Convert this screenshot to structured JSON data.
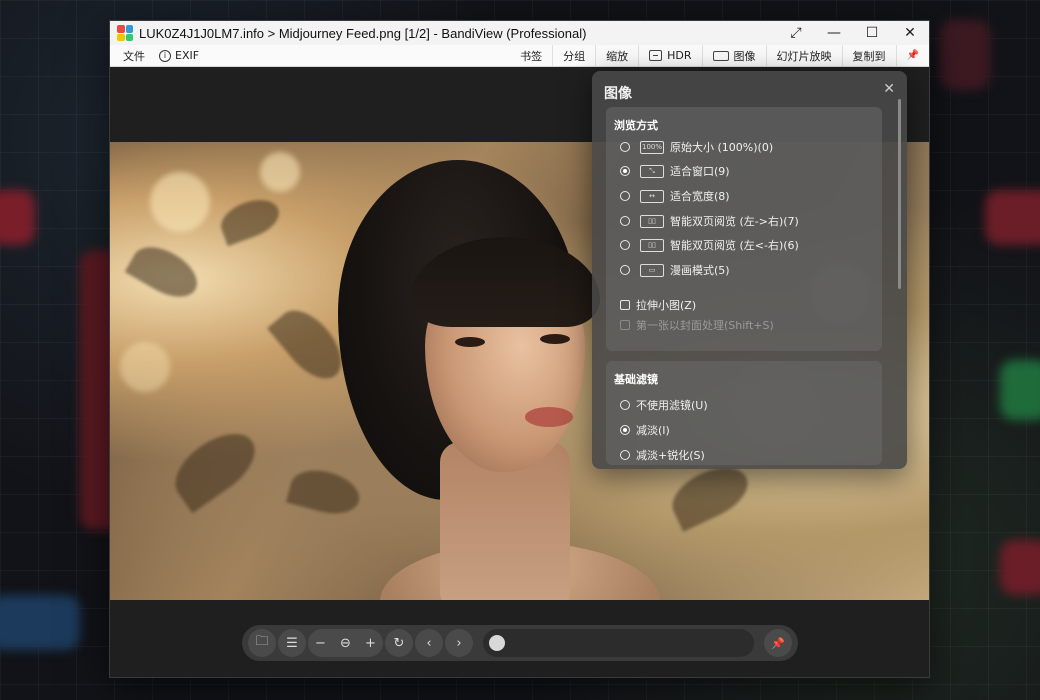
{
  "window": {
    "title": "LUK0Z4J1J0LM7.info > Midjourney Feed.png [1/2] - BandiView (Professional)",
    "controls": {
      "fullscreen": "⤢",
      "minimize": "—",
      "maximize": "☐",
      "close": "✕"
    }
  },
  "menubar": {
    "left": {
      "file": "文件",
      "exif": "EXIF"
    },
    "right": {
      "bookmark": "书签",
      "group": "分组",
      "zoom": "缩放",
      "hdr": "HDR",
      "image": "图像",
      "slideshow": "幻灯片放映",
      "copy_to": "复制到",
      "pin": "📌"
    }
  },
  "panel": {
    "title": "图像",
    "close": "✕",
    "view_mode": {
      "title": "浏览方式",
      "options": [
        {
          "icon": "100%",
          "label": "原始大小 (100%)(0)",
          "selected": false
        },
        {
          "icon": "fit-window",
          "label": "适合窗口(9)",
          "selected": true
        },
        {
          "icon": "fit-width",
          "label": "适合宽度(8)",
          "selected": false
        },
        {
          "icon": "two-page-ltr",
          "label": "智能双页阅览 (左->右)(7)",
          "selected": false
        },
        {
          "icon": "two-page-rtl",
          "label": "智能双页阅览 (左<-右)(6)",
          "selected": false
        },
        {
          "icon": "comic",
          "label": "漫画模式(5)",
          "selected": false
        }
      ],
      "stretch_small": "拉伸小图(Z)",
      "first_as_cover": "第一张以封面处理(Shift+S)"
    },
    "basic_filter": {
      "title": "基础滤镜",
      "options": [
        {
          "label": "不使用滤镜(U)",
          "selected": false
        },
        {
          "label": "减淡(I)",
          "selected": true
        },
        {
          "label": "减淡+锐化(S)",
          "selected": false
        }
      ]
    }
  },
  "toolbar": {
    "buttons": [
      "folder-icon",
      "list-icon",
      "zoom-out-icon",
      "zoom-reset-icon",
      "zoom-in-icon",
      "rotate-icon",
      "prev-icon",
      "next-icon",
      "pin-icon"
    ],
    "seek_position": 0
  },
  "colors": {
    "titlebar": "#f3f3f3",
    "panel": "#484848",
    "toolbar": "#3a3a3a"
  }
}
